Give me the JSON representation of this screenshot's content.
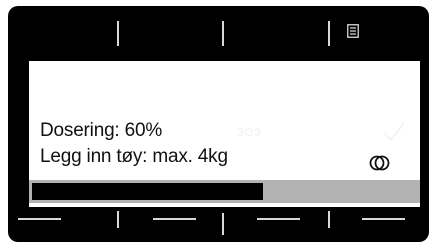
{
  "display": {
    "dosing_text": "Dosering: 60%",
    "load_text": "Legg inn tøy: max. 4kg",
    "ghost_text": "ЗОЗ",
    "progress_fraction": 0.6
  },
  "icons": {
    "menu": "menu-list-icon",
    "check": "check-icon",
    "rings": "rings-icon"
  },
  "colors": {
    "frame": "#000000",
    "panel": "#ffffff",
    "progress_track": "#b3b3b3",
    "progress_fill": "#000000",
    "dividers": "#d8d8d8"
  }
}
